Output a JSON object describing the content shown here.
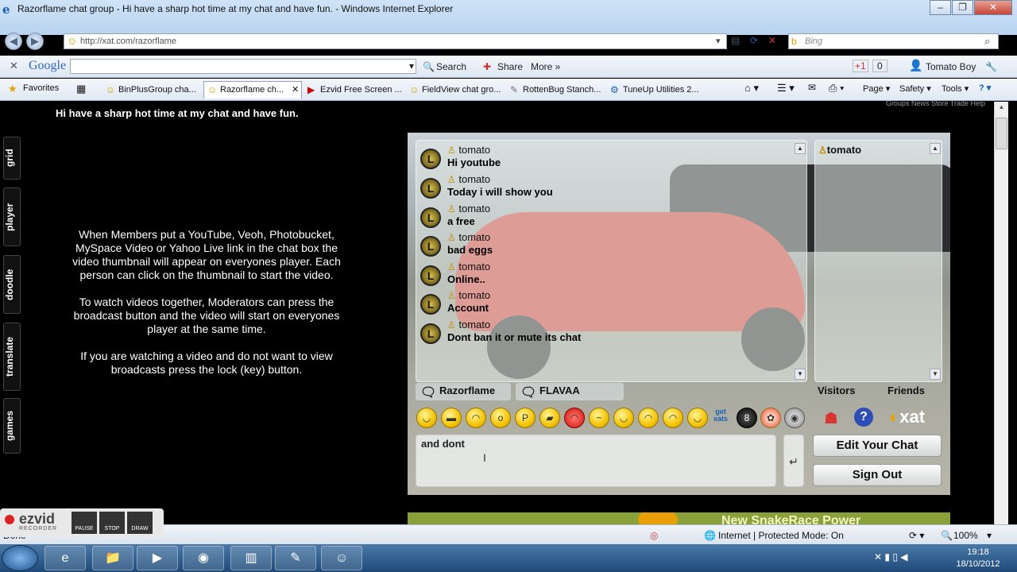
{
  "window": {
    "title": "Razorflame chat group - Hi have a sharp hot time at my chat and have fun. - Windows Internet Explorer",
    "controls": [
      "–",
      "❐",
      "✕"
    ]
  },
  "nav": {
    "url": "http://xat.com/razorflame",
    "search_placeholder": "Bing"
  },
  "google_bar": {
    "logo": "Google",
    "search_label": "Search",
    "share_label": "Share",
    "more_label": "More »",
    "plus_one": "+1",
    "count": "0",
    "user": "Tomato Boy"
  },
  "favorites": {
    "label": "Favorites",
    "tabs": [
      {
        "label": "BinPlusGroup cha...",
        "icon": "☺"
      },
      {
        "label": "Razorflame ch...",
        "icon": "☺"
      },
      {
        "label": "Ezvid Free Screen ...",
        "icon": "▶"
      },
      {
        "label": "FieldView chat gro...",
        "icon": "☺"
      },
      {
        "label": "RottenBug Stanch...",
        "icon": "✎"
      },
      {
        "label": "TuneUp Utilities 2...",
        "icon": "⚙"
      }
    ],
    "commands": [
      "Page ▾",
      "Safety ▾",
      "Tools ▾"
    ]
  },
  "page": {
    "header_text": "Hi have a sharp hot time at my chat and have fun.",
    "top_menu": "Groups  News  Store  Trade  Help",
    "side_tabs": [
      "grid",
      "player",
      "doodle",
      "translate",
      "games"
    ],
    "info_paragraphs": [
      "When Members put a YouTube, Veoh, Photobucket, MySpace Video or Yahoo Live link in the chat box the video thumbnail will appear on everyones player. Each person can click on the thumbnail to start the video.",
      "To watch videos together, Moderators can press the broadcast button and the video will start on everyones player at the same time.",
      "If you are watching a video and do not want to view broadcasts press the lock (key) button."
    ]
  },
  "chat": {
    "messages": [
      {
        "user": "tomato",
        "text": "Hi youtube"
      },
      {
        "user": "tomato",
        "text": "Today i will show you"
      },
      {
        "user": "tomato",
        "text": "a free"
      },
      {
        "user": "tomato",
        "text": "bad eggs"
      },
      {
        "user": "tomato",
        "text": "Online.."
      },
      {
        "user": "tomato",
        "text": "Account"
      },
      {
        "user": "tomato",
        "text": "Dont ban it or mute its chat"
      }
    ],
    "users": [
      {
        "name": "tomato"
      }
    ],
    "tabs": {
      "main": "Razorflame",
      "pc": "FLAVAA",
      "visitors": "Visitors",
      "friends": "Friends"
    },
    "smiley_get_xats": "get xats",
    "brand": "xat",
    "input_value": "and dont",
    "edit_button": "Edit Your Chat",
    "signout_button": "Sign Out",
    "banner_text": "New SnakeRace Power"
  },
  "status": {
    "left": "Done",
    "zone": "Internet | Protected Mode: On",
    "zoom": "100%"
  },
  "ezvid": {
    "logo": "ezvid",
    "sub": "RECORDER",
    "buttons": [
      "PAUSE",
      "STOP",
      "DRAW"
    ]
  },
  "taskbar": {
    "time": "19:18",
    "date": "18/10/2012"
  }
}
